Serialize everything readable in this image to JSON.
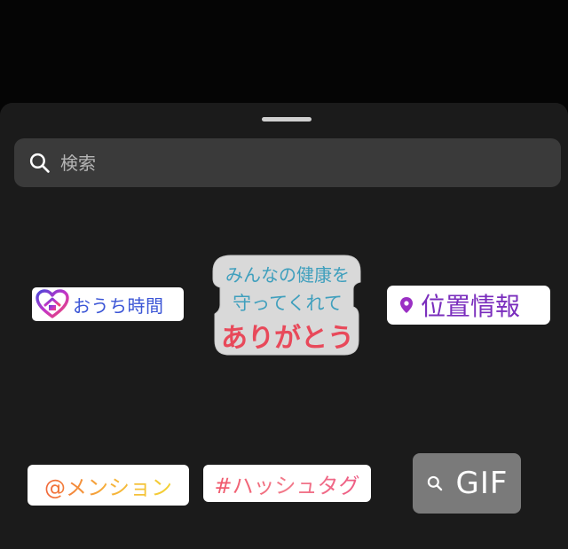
{
  "search": {
    "placeholder": "検索",
    "icon": "search-icon"
  },
  "stickers": {
    "ouchi_jikan": {
      "label": "おうち時間",
      "icon": "heart-house-icon",
      "color": "#3b55d6"
    },
    "health_thanks": {
      "line1": "みんなの健康を",
      "line2": "守ってくれて",
      "line3": "ありがとう",
      "colors": {
        "blue": "#3f9fbd",
        "red": "#e8495a"
      }
    },
    "location": {
      "label": "位置情報",
      "icon": "location-pin-icon",
      "color": "#7a2dbd"
    },
    "mention": {
      "label": "@メンション",
      "color": "#f2a233"
    },
    "hashtag": {
      "label": "#ハッシュタグ",
      "color": "#ee5b70"
    },
    "gif": {
      "label": "GIF",
      "icon": "search-icon"
    }
  }
}
